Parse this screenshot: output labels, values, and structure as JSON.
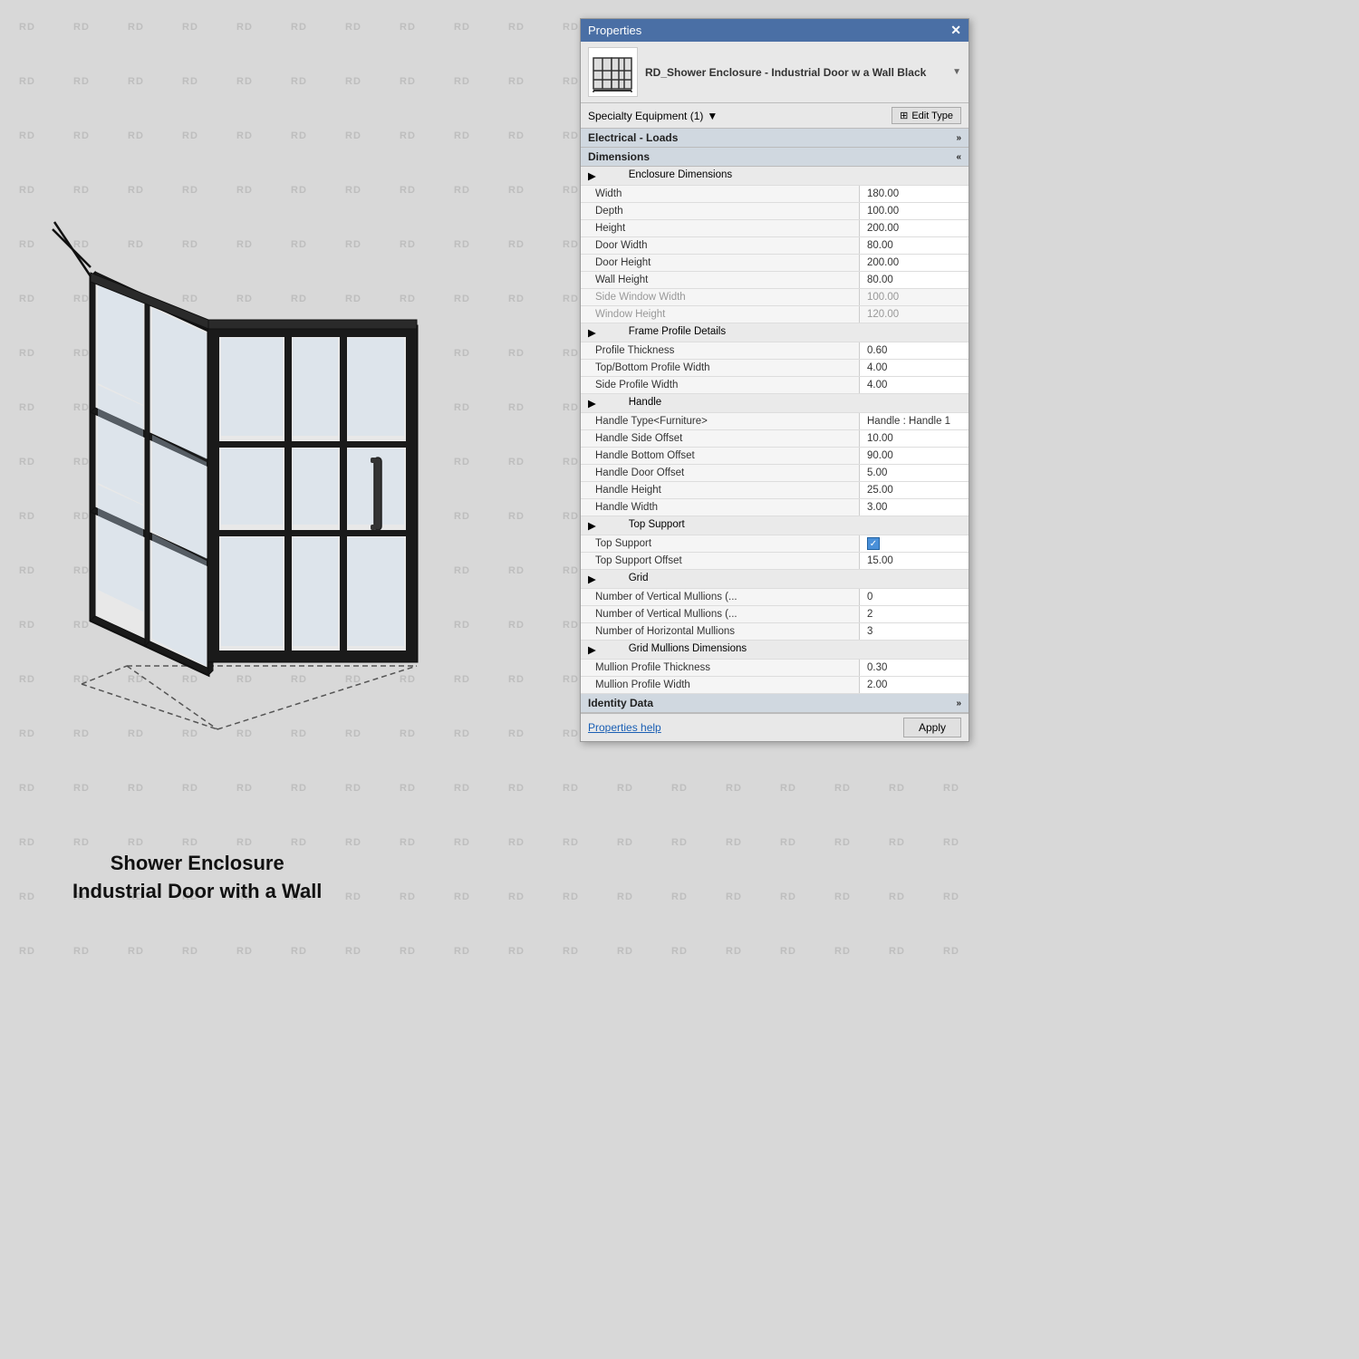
{
  "watermark": {
    "text": "RD"
  },
  "drawing": {
    "caption_line1": "Shower Enclosure",
    "caption_line2": "Industrial Door with a Wall"
  },
  "panel": {
    "title": "Properties",
    "close_label": "✕",
    "component_name": "RD_Shower Enclosure - Industrial Door w a Wall Black",
    "type_selector_label": "Specialty Equipment (1)",
    "edit_type_label": "Edit Type",
    "sections": [
      {
        "id": "electrical",
        "label": "Electrical - Loads",
        "collapsed": true,
        "double_arrow": "»"
      },
      {
        "id": "dimensions",
        "label": "Dimensions",
        "collapsed": false,
        "double_arrow": "«"
      }
    ],
    "enclosure_dimensions_label": "Enclosure Dimensions",
    "properties": [
      {
        "label": "Width",
        "value": "180.00",
        "grayed": false
      },
      {
        "label": "Depth",
        "value": "100.00",
        "grayed": false
      },
      {
        "label": "Height",
        "value": "200.00",
        "grayed": false
      },
      {
        "label": "Door Width",
        "value": "80.00",
        "grayed": false
      },
      {
        "label": "Door Height",
        "value": "200.00",
        "grayed": false
      },
      {
        "label": "Wall Height",
        "value": "80.00",
        "grayed": false
      },
      {
        "label": "Side Window Width",
        "value": "100.00",
        "grayed": true
      },
      {
        "label": "Window Height",
        "value": "120.00",
        "grayed": true
      }
    ],
    "frame_profile_label": "Frame Profile Details",
    "frame_properties": [
      {
        "label": "Profile Thickness",
        "value": "0.60",
        "grayed": false
      },
      {
        "label": "Top/Bottom Profile Width",
        "value": "4.00",
        "grayed": false
      },
      {
        "label": "Side Profile Width",
        "value": "4.00",
        "grayed": false
      }
    ],
    "handle_label": "Handle",
    "handle_properties": [
      {
        "label": "Handle Type<Furniture>",
        "value": "Handle : Handle 1",
        "grayed": false
      },
      {
        "label": "Handle Side Offset",
        "value": "10.00",
        "grayed": false
      },
      {
        "label": "Handle Bottom Offset",
        "value": "90.00",
        "grayed": false
      },
      {
        "label": "Handle Door Offset",
        "value": "5.00",
        "grayed": false
      },
      {
        "label": "Handle Height",
        "value": "25.00",
        "grayed": false
      },
      {
        "label": "Handle Width",
        "value": "3.00",
        "grayed": false
      }
    ],
    "top_support_section_label": "Top Support",
    "top_support_properties": [
      {
        "label": "Top Support",
        "value": "checkbox",
        "checked": true
      },
      {
        "label": "Top Support Offset",
        "value": "15.00",
        "grayed": false
      }
    ],
    "grid_section_label": "Grid",
    "grid_properties": [
      {
        "label": "Number of Vertical Mullions (...",
        "value": "0",
        "grayed": false
      },
      {
        "label": "Number of Vertical Mullions (...",
        "value": "2",
        "grayed": false
      },
      {
        "label": "Number of Horizontal Mullions",
        "value": "3",
        "grayed": false
      }
    ],
    "grid_mullions_label": "Grid Mullions Dimensions",
    "grid_mullion_properties": [
      {
        "label": "Mullion Profile Thickness",
        "value": "0.30",
        "grayed": false
      },
      {
        "label": "Mullion Profile Width",
        "value": "2.00",
        "grayed": false
      }
    ],
    "identity_data_label": "Identity Data",
    "identity_double_arrow": "»",
    "footer": {
      "help_label": "Properties help",
      "apply_label": "Apply"
    }
  }
}
